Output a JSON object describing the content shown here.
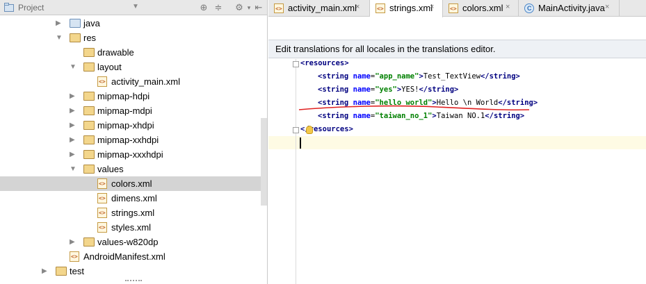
{
  "project_panel": {
    "header_label": "Project",
    "tree": [
      {
        "label": "java",
        "kind": "folder-blue",
        "expanded": false
      },
      {
        "label": "res",
        "kind": "folder-res",
        "expanded": true
      },
      {
        "label": "drawable",
        "kind": "folder",
        "expanded": null
      },
      {
        "label": "layout",
        "kind": "folder",
        "expanded": true
      },
      {
        "label": "activity_main.xml",
        "kind": "xml",
        "expanded": null
      },
      {
        "label": "mipmap-hdpi",
        "kind": "folder",
        "expanded": false
      },
      {
        "label": "mipmap-mdpi",
        "kind": "folder",
        "expanded": false
      },
      {
        "label": "mipmap-xhdpi",
        "kind": "folder",
        "expanded": false
      },
      {
        "label": "mipmap-xxhdpi",
        "kind": "folder",
        "expanded": false
      },
      {
        "label": "mipmap-xxxhdpi",
        "kind": "folder",
        "expanded": false
      },
      {
        "label": "values",
        "kind": "folder",
        "expanded": true
      },
      {
        "label": "colors.xml",
        "kind": "xml",
        "expanded": null,
        "selected": true
      },
      {
        "label": "dimens.xml",
        "kind": "xml",
        "expanded": null
      },
      {
        "label": "strings.xml",
        "kind": "xml",
        "expanded": null
      },
      {
        "label": "styles.xml",
        "kind": "xml",
        "expanded": null
      },
      {
        "label": "values-w820dp",
        "kind": "folder",
        "expanded": false
      },
      {
        "label": "AndroidManifest.xml",
        "kind": "xml",
        "expanded": null
      },
      {
        "label": "test",
        "kind": "folder",
        "expanded": false
      }
    ]
  },
  "tabs": [
    {
      "label": "activity_main.xml",
      "icon": "xml-file-icon",
      "active": false
    },
    {
      "label": "strings.xml",
      "icon": "xml-file-icon",
      "active": true
    },
    {
      "label": "colors.xml",
      "icon": "xml-file-icon",
      "active": false
    },
    {
      "label": "MainActivity.java",
      "icon": "java-class-icon",
      "active": false
    }
  ],
  "tab_close_glyph": "×",
  "notice": {
    "text": "Edit translations for all locales in the translations editor."
  },
  "code": {
    "open_tag": "resources",
    "close_tag": "resources",
    "strings": [
      {
        "name": "app_name",
        "text": "Test_TextView"
      },
      {
        "name": "yes",
        "text": "YES!"
      },
      {
        "name": "hello_world",
        "text": "Hello \\n World"
      },
      {
        "name": "taiwan_no_1",
        "text": "Taiwan NO.1"
      }
    ]
  },
  "colors": {
    "xml_tag": "#000080",
    "xml_attr": "#0000ff",
    "xml_value": "#008000",
    "annotation_underline": "#e02020",
    "selection": "#d4d4d4",
    "current_line": "#fefbe4"
  }
}
